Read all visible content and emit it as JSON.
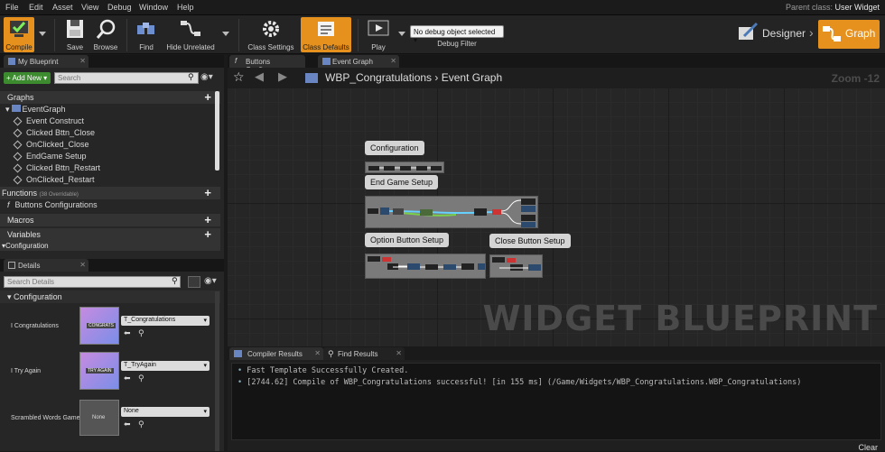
{
  "menu": [
    "File",
    "Edit",
    "Asset",
    "View",
    "Debug",
    "Window",
    "Help"
  ],
  "parent_class": {
    "label": "Parent class:",
    "value": "User Widget"
  },
  "toolbar": {
    "compile": "Compile",
    "save": "Save",
    "browse": "Browse",
    "find": "Find",
    "hide_unrelated": "Hide Unrelated",
    "class_settings": "Class Settings",
    "class_defaults": "Class Defaults",
    "play": "Play",
    "debug_select": "No debug object selected",
    "debug_filter": "Debug Filter",
    "designer": "Designer",
    "graph": "Graph"
  },
  "my_blueprint": {
    "tab": "My Blueprint",
    "add_new": "Add New",
    "search_placeholder": "Search",
    "graphs_header": "Graphs",
    "event_graph": "EventGraph",
    "events": [
      "Event Construct",
      "Clicked Bttn_Close",
      "OnClicked_Close",
      "EndGame Setup",
      "Clicked Bttn_Restart",
      "OnClicked_Restart"
    ],
    "functions_header": "Functions",
    "functions_note": "(38 Overridable)",
    "functions": [
      "Buttons Configurations"
    ],
    "macros_header": "Macros",
    "variables_header": "Variables",
    "configuration_header": "Configuration"
  },
  "details": {
    "tab": "Details",
    "search_placeholder": "Search Details",
    "section": "Configuration",
    "props": [
      {
        "label": "I Congratulations",
        "asset": "T_Congratulations",
        "thumb": "CONGRATS"
      },
      {
        "label": "I Try Again",
        "asset": "T_TryAgain",
        "thumb": "TRY AGAIN"
      },
      {
        "label": "Scrambled Words Game",
        "asset": "None",
        "thumb": "None"
      }
    ]
  },
  "graph": {
    "tabs": [
      "Buttons Configura",
      "Event Graph"
    ],
    "breadcrumb_root": "WBP_Congratulations",
    "breadcrumb_sep": "›",
    "breadcrumb_leaf": "Event Graph",
    "zoom": "Zoom -12",
    "watermark": "WIDGET BLUEPRINT",
    "comments": [
      "Configuration",
      "End Game Setup",
      "Option Button Setup",
      "Close Button Setup"
    ]
  },
  "bottom": {
    "tabs": [
      "Compiler Results",
      "Find Results"
    ],
    "log": [
      "Fast Template Successfully Created.",
      "[2744.62] Compile of WBP_Congratulations successful! [in 155 ms] (/Game/Widgets/WBP_Congratulations.WBP_Congratulations)"
    ],
    "clear": "Clear"
  },
  "colors": {
    "accent": "#e6901d",
    "add_new": "#3d8b2f"
  }
}
